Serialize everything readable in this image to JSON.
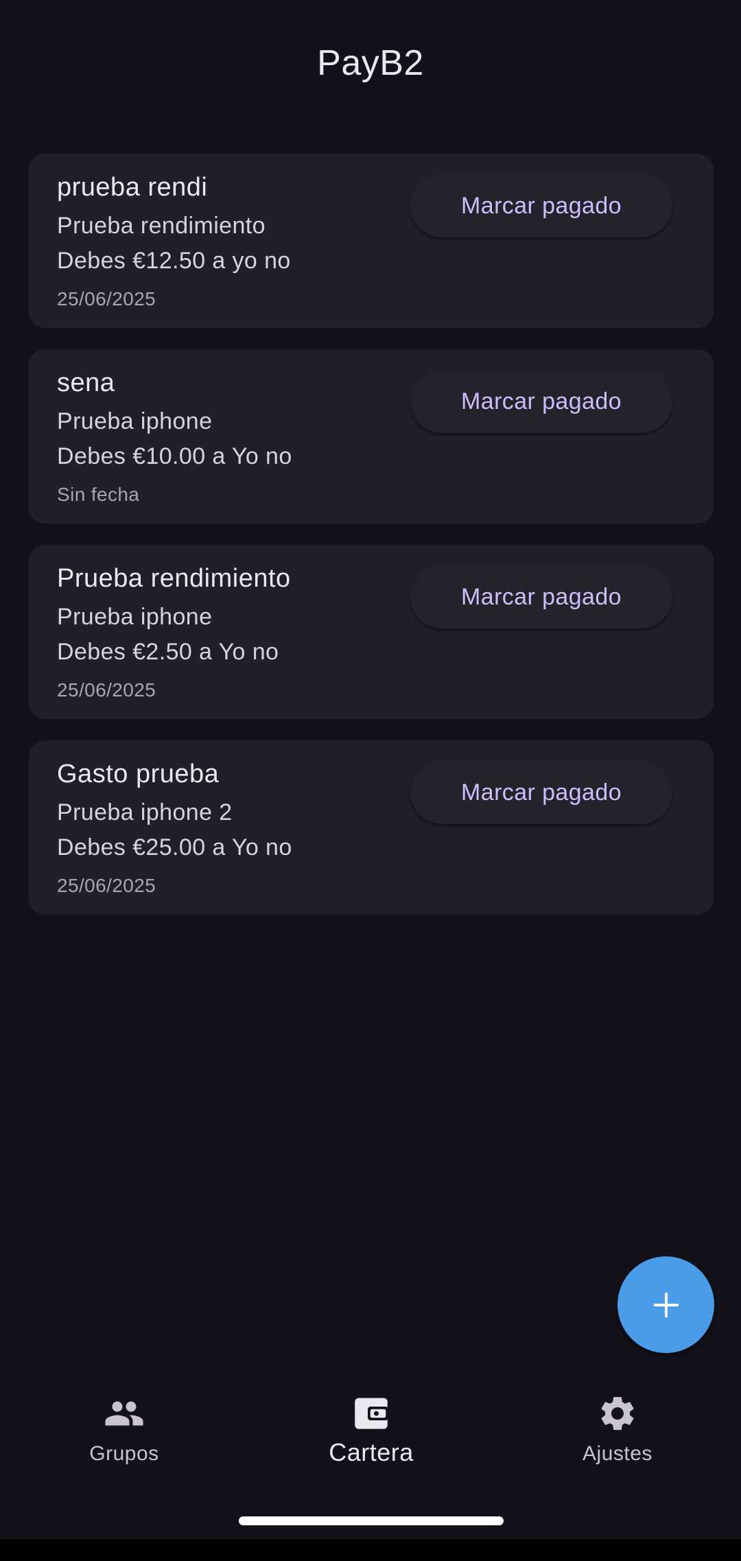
{
  "app": {
    "title": "PayB2"
  },
  "debts": [
    {
      "title": "prueba rendi",
      "group": "Prueba rendimiento",
      "debt_text": "Debes €12.50 a yo no",
      "date": "25/06/2025",
      "action_label": "Marcar pagado"
    },
    {
      "title": "sena",
      "group": "Prueba iphone",
      "debt_text": "Debes €10.00 a Yo no",
      "date": "Sin fecha",
      "action_label": "Marcar pagado"
    },
    {
      "title": "Prueba rendimiento",
      "group": "Prueba iphone",
      "debt_text": "Debes €2.50 a Yo no",
      "date": "25/06/2025",
      "action_label": "Marcar pagado"
    },
    {
      "title": "Gasto prueba",
      "group": "Prueba iphone 2",
      "debt_text": "Debes €25.00 a Yo no",
      "date": "25/06/2025",
      "action_label": "Marcar pagado"
    }
  ],
  "fab": {
    "icon": "plus-icon"
  },
  "nav": {
    "items": [
      {
        "label": "Grupos",
        "icon": "groups-icon",
        "active": false
      },
      {
        "label": "Cartera",
        "icon": "wallet-icon",
        "active": true
      },
      {
        "label": "Ajustes",
        "icon": "gear-icon",
        "active": false
      }
    ]
  },
  "colors": {
    "background": "#13121a",
    "card": "#211f28",
    "accent_text": "#cdbdfb",
    "fab": "#4a9ce9"
  }
}
